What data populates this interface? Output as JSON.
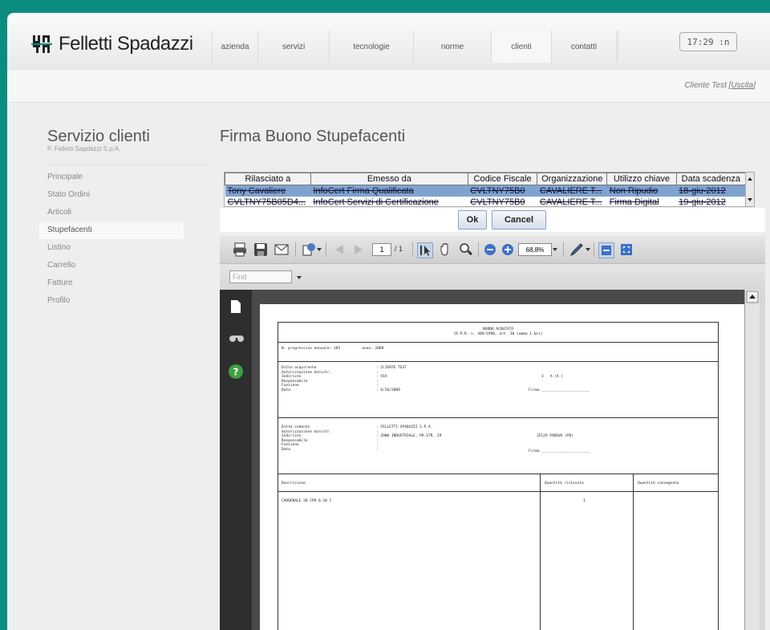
{
  "brand": {
    "name": "Felletti Spadazzi",
    "accent": "#0a8c7f"
  },
  "nav": {
    "items": [
      {
        "label": "azienda"
      },
      {
        "label": "servizi"
      },
      {
        "label": "tecnologie"
      },
      {
        "label": "norme"
      },
      {
        "label": "clienti",
        "active": true
      },
      {
        "label": "contatti"
      }
    ],
    "clock": "17:29 :n"
  },
  "user": {
    "name": "Cliente Test",
    "logout": "Uscita"
  },
  "sidebar": {
    "title": "Servizio clienti",
    "subtitle": "P. Felletti Sapdazzi S.p.A.",
    "items": [
      {
        "label": "Principale"
      },
      {
        "label": "Stato Ordini"
      },
      {
        "label": "Articoli"
      },
      {
        "label": "Stupefacenti",
        "active": true
      },
      {
        "label": "Listino"
      },
      {
        "label": "Carrello"
      },
      {
        "label": "Fatture"
      },
      {
        "label": "Profilo"
      }
    ]
  },
  "main": {
    "title": "Firma Buono Stupefacenti"
  },
  "certs": {
    "headers": [
      "Rilasciato a",
      "Emesso da",
      "Codice Fiscale",
      "Organizzazione",
      "Utilizzo chiave",
      "Data scadenza"
    ],
    "rows": [
      [
        "Tony Cavaliere",
        "InfoCert Firma Qualificata",
        "CVLTNY75B0",
        "CAVALIERE T...",
        "Non Ripudio",
        "18-giu-2012"
      ],
      [
        "CVLTNY75B05D4...",
        "InfoCert Servizi di Certificazione",
        "CVLTNY75B0",
        "CAVALIERE T...",
        "Firma Digital",
        "19-giu-2012"
      ]
    ]
  },
  "buttons": {
    "ok": "Ok",
    "cancel": "Cancel"
  },
  "toolbar": {
    "page_current": "1",
    "page_total": "/ 1",
    "zoom": "68,8%",
    "icons": [
      "print-icon",
      "save-icon",
      "email-icon",
      "sign-icon",
      "prev-page-icon",
      "next-page-icon",
      "select-tool-icon",
      "hand-tool-icon",
      "zoom-tool-icon",
      "zoom-out-icon",
      "zoom-in-icon",
      "pen-icon",
      "view-single-icon",
      "fit-icon"
    ]
  },
  "find": {
    "placeholder": "Find"
  },
  "document": {
    "title1": "BUONO ACQUISTO",
    "title2": "(D.P.R. n. 309/1990, art. 38 comma 1 bis)",
    "progressivo": "N. progressivo annuale: 105          anno: 2009",
    "buyer_labels": "Ditta acquirente\nAutorizzazione ministr.\nIndirizzo\nResponsabile\nFunzione\nData",
    "buyer_values": ": CLIENTE TEST\n:\n: VIA\n:\n:\n: 6/26/2009",
    "buyer_extra": "3   A (A )",
    "firma": "Firma ______________________",
    "seller_labels": "Ditta cedente\nAutorizzazione ministr.\nIndirizzo\nResponsabile\nFunzione\nData",
    "seller_values": ": FELLETTI SPADAZZI S.P.A.\n:\n: ZONA INDUSTRIALE, PR.STR. 29\n:\n:\n:",
    "seller_extra": "35129 PADOVA (PD)",
    "col_desc": "Descrizione",
    "col_qty_req": "Quantità richiesta",
    "col_qty_del": "Quantità consegnata",
    "item_desc": "CARDENALE 20 CPR 0,10 C",
    "item_qty": "1"
  }
}
